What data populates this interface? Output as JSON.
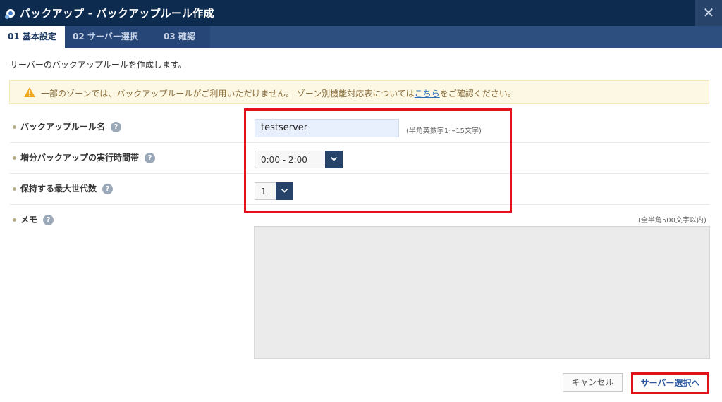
{
  "window": {
    "title": "バックアップ - バックアップルール作成",
    "close_glyph": "✕"
  },
  "tabs": [
    {
      "label": "01 基本設定",
      "active": true
    },
    {
      "label": "02 サーバー選択",
      "active": false
    },
    {
      "label": "03 確認",
      "active": false
    }
  ],
  "intro": "サーバーのバックアップルールを作成します。",
  "notice": {
    "text_before": "一部のゾーンでは、バックアップルールがご利用いただけません。 ゾーン別機能対応表については",
    "link": "こちら",
    "text_after": "をご確認ください。",
    "icon": "warning-icon"
  },
  "form": {
    "rule_name": {
      "label": "バックアップルール名",
      "value": "testserver",
      "hint": "(半角英数字1～15文字)"
    },
    "time_window": {
      "label": "増分バックアップの実行時間帯",
      "value": "0:00 - 2:00"
    },
    "generations": {
      "label": "保持する最大世代数",
      "value": "1"
    },
    "memo": {
      "label": "メモ",
      "hint": "(全半角500文字以内)",
      "value": ""
    },
    "help_glyph": "?"
  },
  "buttons": {
    "cancel": "キャンセル",
    "next": "サーバー選択へ"
  },
  "colors": {
    "title_bar": "#0d2a4f",
    "tab_bar": "#2d4f80",
    "highlight": "#e2121b",
    "notice_bg": "#fcf8e4"
  }
}
